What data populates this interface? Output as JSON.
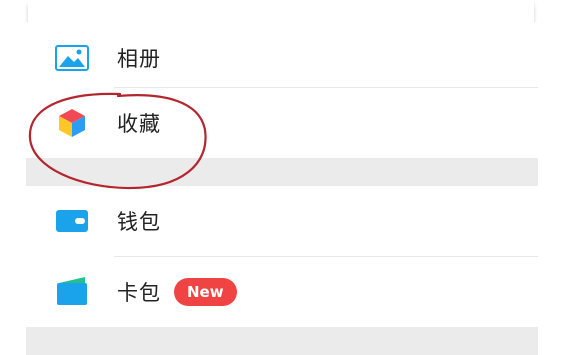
{
  "menu": {
    "items": [
      {
        "label": "相册",
        "icon": "album-icon"
      },
      {
        "label": "收藏",
        "icon": "favorites-icon"
      },
      {
        "label": "钱包",
        "icon": "wallet-icon"
      },
      {
        "label": "卡包",
        "icon": "card-wallet-icon",
        "badge": "New"
      }
    ]
  },
  "colors": {
    "icon_blue": "#1aa3ea",
    "badge_red": "#f04444",
    "annotation_red": "#b3262e",
    "separator_gray": "#ebebeb"
  }
}
